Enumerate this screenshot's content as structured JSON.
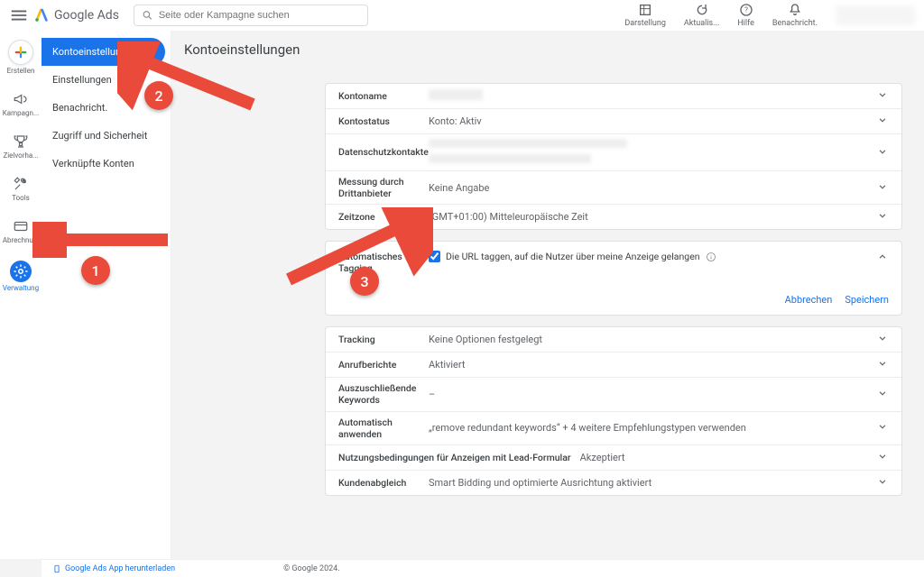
{
  "brand": {
    "name": "Google Ads"
  },
  "search": {
    "placeholder": "Seite oder Kampagne suchen"
  },
  "header_icons": {
    "appearance": "Darstellung",
    "refresh": "Aktualis...",
    "help": "Hilfe",
    "notifications": "Benachricht."
  },
  "rail": {
    "create": "Erstellen",
    "campaigns": "Kampagn...",
    "goals": "Zielvorha...",
    "tools": "Tools",
    "billing": "Abrechnu...",
    "admin": "Verwaltung"
  },
  "sidebar": {
    "items": [
      "Kontoeinstellungen",
      "Einstellungen",
      "Benachricht.",
      "Zugriff und Sicherheit",
      "Verknüpfte Konten"
    ]
  },
  "page": {
    "title": "Kontoeinstellungen"
  },
  "panel1": {
    "account_name_label": "Kontoname",
    "account_status_label": "Kontostatus",
    "account_status_value": "Konto: Aktiv",
    "privacy_label": "Datenschutzkontakte",
    "thirdparty_label": "Messung durch Drittanbieter",
    "thirdparty_value": "Keine Angabe",
    "timezone_label": "Zeitzone",
    "timezone_value": "(GMT+01:00) Mitteleuropäische Zeit"
  },
  "tagging": {
    "label": "Automatisches Tagging",
    "checkbox_label": "Die URL taggen, auf die Nutzer über meine Anzeige gelangen",
    "cancel": "Abbrechen",
    "save": "Speichern"
  },
  "panel2": {
    "tracking_label": "Tracking",
    "tracking_value": "Keine Optionen festgelegt",
    "callreports_label": "Anrufberichte",
    "callreports_value": "Aktiviert",
    "negkw_label": "Auszuschließende Keywords",
    "negkw_value": "–",
    "autoapply_label": "Automatisch anwenden",
    "autoapply_value": "„remove redundant keywords“ + 4 weitere Empfehlungstypen verwenden",
    "leadform_label": "Nutzungsbedingungen für Anzeigen mit Lead-Formular",
    "leadform_value": "Akzeptiert",
    "custmatch_label": "Kundenabgleich",
    "custmatch_value": "Smart Bidding und optimierte Ausrichtung aktiviert"
  },
  "footer": {
    "applink": "Google Ads App herunterladen",
    "copyright": "© Google 2024."
  },
  "annotations": {
    "one": "1",
    "two": "2",
    "three": "3"
  }
}
